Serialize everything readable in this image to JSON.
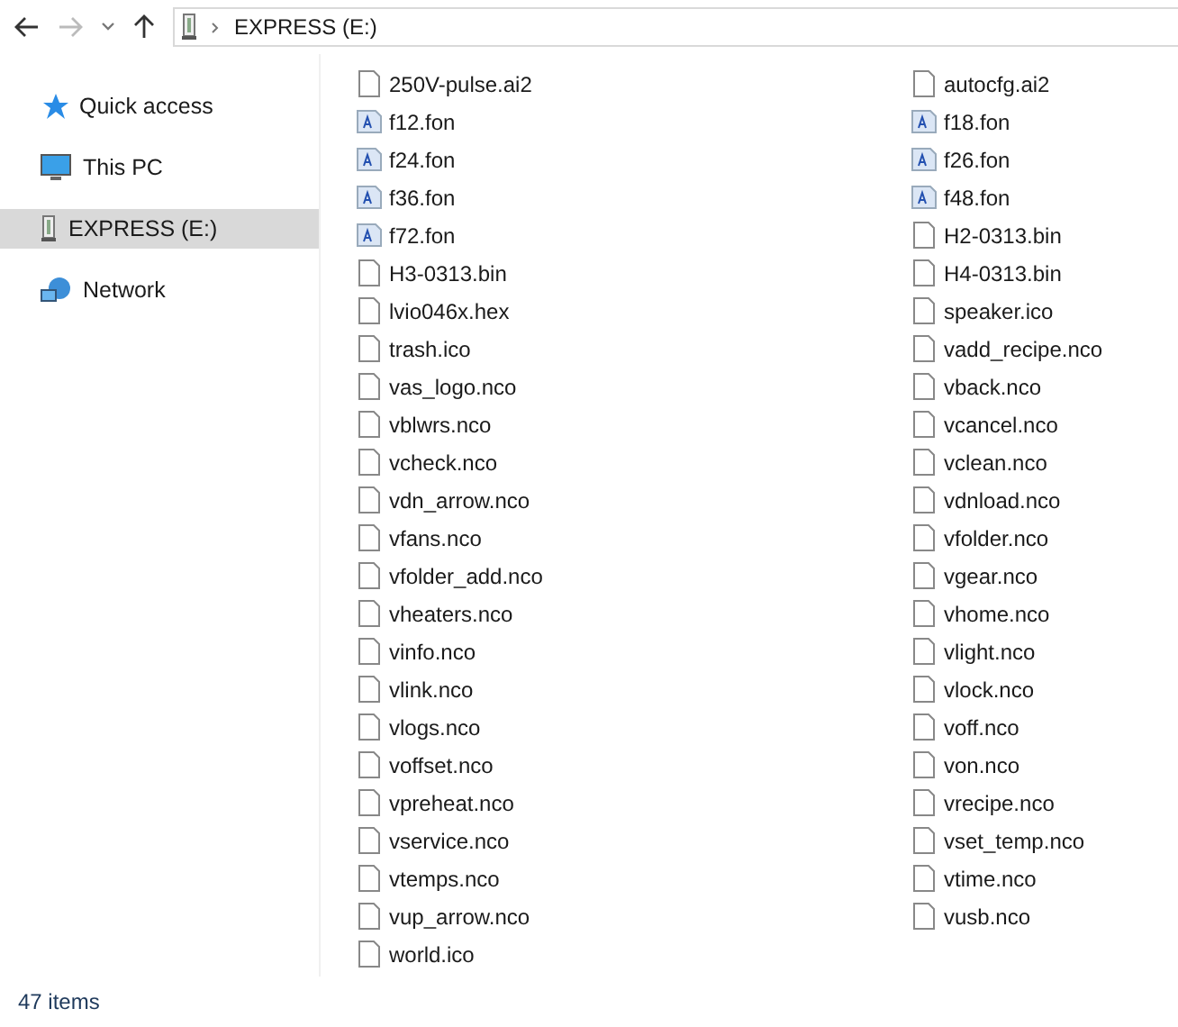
{
  "address_bar": {
    "path": "EXPRESS (E:)"
  },
  "sidebar": {
    "items": [
      {
        "label": "Quick access",
        "kind": "quick",
        "selected": false
      },
      {
        "label": "This PC",
        "kind": "pc",
        "selected": false
      },
      {
        "label": "EXPRESS (E:)",
        "kind": "drive",
        "selected": true
      },
      {
        "label": "Network",
        "kind": "network",
        "selected": false
      }
    ]
  },
  "files": [
    {
      "name": "250V-pulse.ai2",
      "kind": "file"
    },
    {
      "name": "autocfg.ai2",
      "kind": "file"
    },
    {
      "name": "f12.fon",
      "kind": "font"
    },
    {
      "name": "f18.fon",
      "kind": "font"
    },
    {
      "name": "f24.fon",
      "kind": "font"
    },
    {
      "name": "f26.fon",
      "kind": "font"
    },
    {
      "name": "f36.fon",
      "kind": "font"
    },
    {
      "name": "f48.fon",
      "kind": "font"
    },
    {
      "name": "f72.fon",
      "kind": "font"
    },
    {
      "name": "H2-0313.bin",
      "kind": "file"
    },
    {
      "name": "H3-0313.bin",
      "kind": "file"
    },
    {
      "name": "H4-0313.bin",
      "kind": "file"
    },
    {
      "name": "lvio046x.hex",
      "kind": "file"
    },
    {
      "name": "speaker.ico",
      "kind": "file"
    },
    {
      "name": "trash.ico",
      "kind": "file"
    },
    {
      "name": "vadd_recipe.nco",
      "kind": "file"
    },
    {
      "name": "vas_logo.nco",
      "kind": "file"
    },
    {
      "name": "vback.nco",
      "kind": "file"
    },
    {
      "name": "vblwrs.nco",
      "kind": "file"
    },
    {
      "name": "vcancel.nco",
      "kind": "file"
    },
    {
      "name": "vcheck.nco",
      "kind": "file"
    },
    {
      "name": "vclean.nco",
      "kind": "file"
    },
    {
      "name": "vdn_arrow.nco",
      "kind": "file"
    },
    {
      "name": "vdnload.nco",
      "kind": "file"
    },
    {
      "name": "vfans.nco",
      "kind": "file"
    },
    {
      "name": "vfolder.nco",
      "kind": "file"
    },
    {
      "name": "vfolder_add.nco",
      "kind": "file"
    },
    {
      "name": "vgear.nco",
      "kind": "file"
    },
    {
      "name": "vheaters.nco",
      "kind": "file"
    },
    {
      "name": "vhome.nco",
      "kind": "file"
    },
    {
      "name": "vinfo.nco",
      "kind": "file"
    },
    {
      "name": "vlight.nco",
      "kind": "file"
    },
    {
      "name": "vlink.nco",
      "kind": "file"
    },
    {
      "name": "vlock.nco",
      "kind": "file"
    },
    {
      "name": "vlogs.nco",
      "kind": "file"
    },
    {
      "name": "voff.nco",
      "kind": "file"
    },
    {
      "name": "voffset.nco",
      "kind": "file"
    },
    {
      "name": "von.nco",
      "kind": "file"
    },
    {
      "name": "vpreheat.nco",
      "kind": "file"
    },
    {
      "name": "vrecipe.nco",
      "kind": "file"
    },
    {
      "name": "vservice.nco",
      "kind": "file"
    },
    {
      "name": "vset_temp.nco",
      "kind": "file"
    },
    {
      "name": "vtemps.nco",
      "kind": "file"
    },
    {
      "name": "vtime.nco",
      "kind": "file"
    },
    {
      "name": "vup_arrow.nco",
      "kind": "file"
    },
    {
      "name": "vusb.nco",
      "kind": "file"
    },
    {
      "name": "world.ico",
      "kind": "file"
    }
  ],
  "status_bar": {
    "count": "47 items"
  }
}
